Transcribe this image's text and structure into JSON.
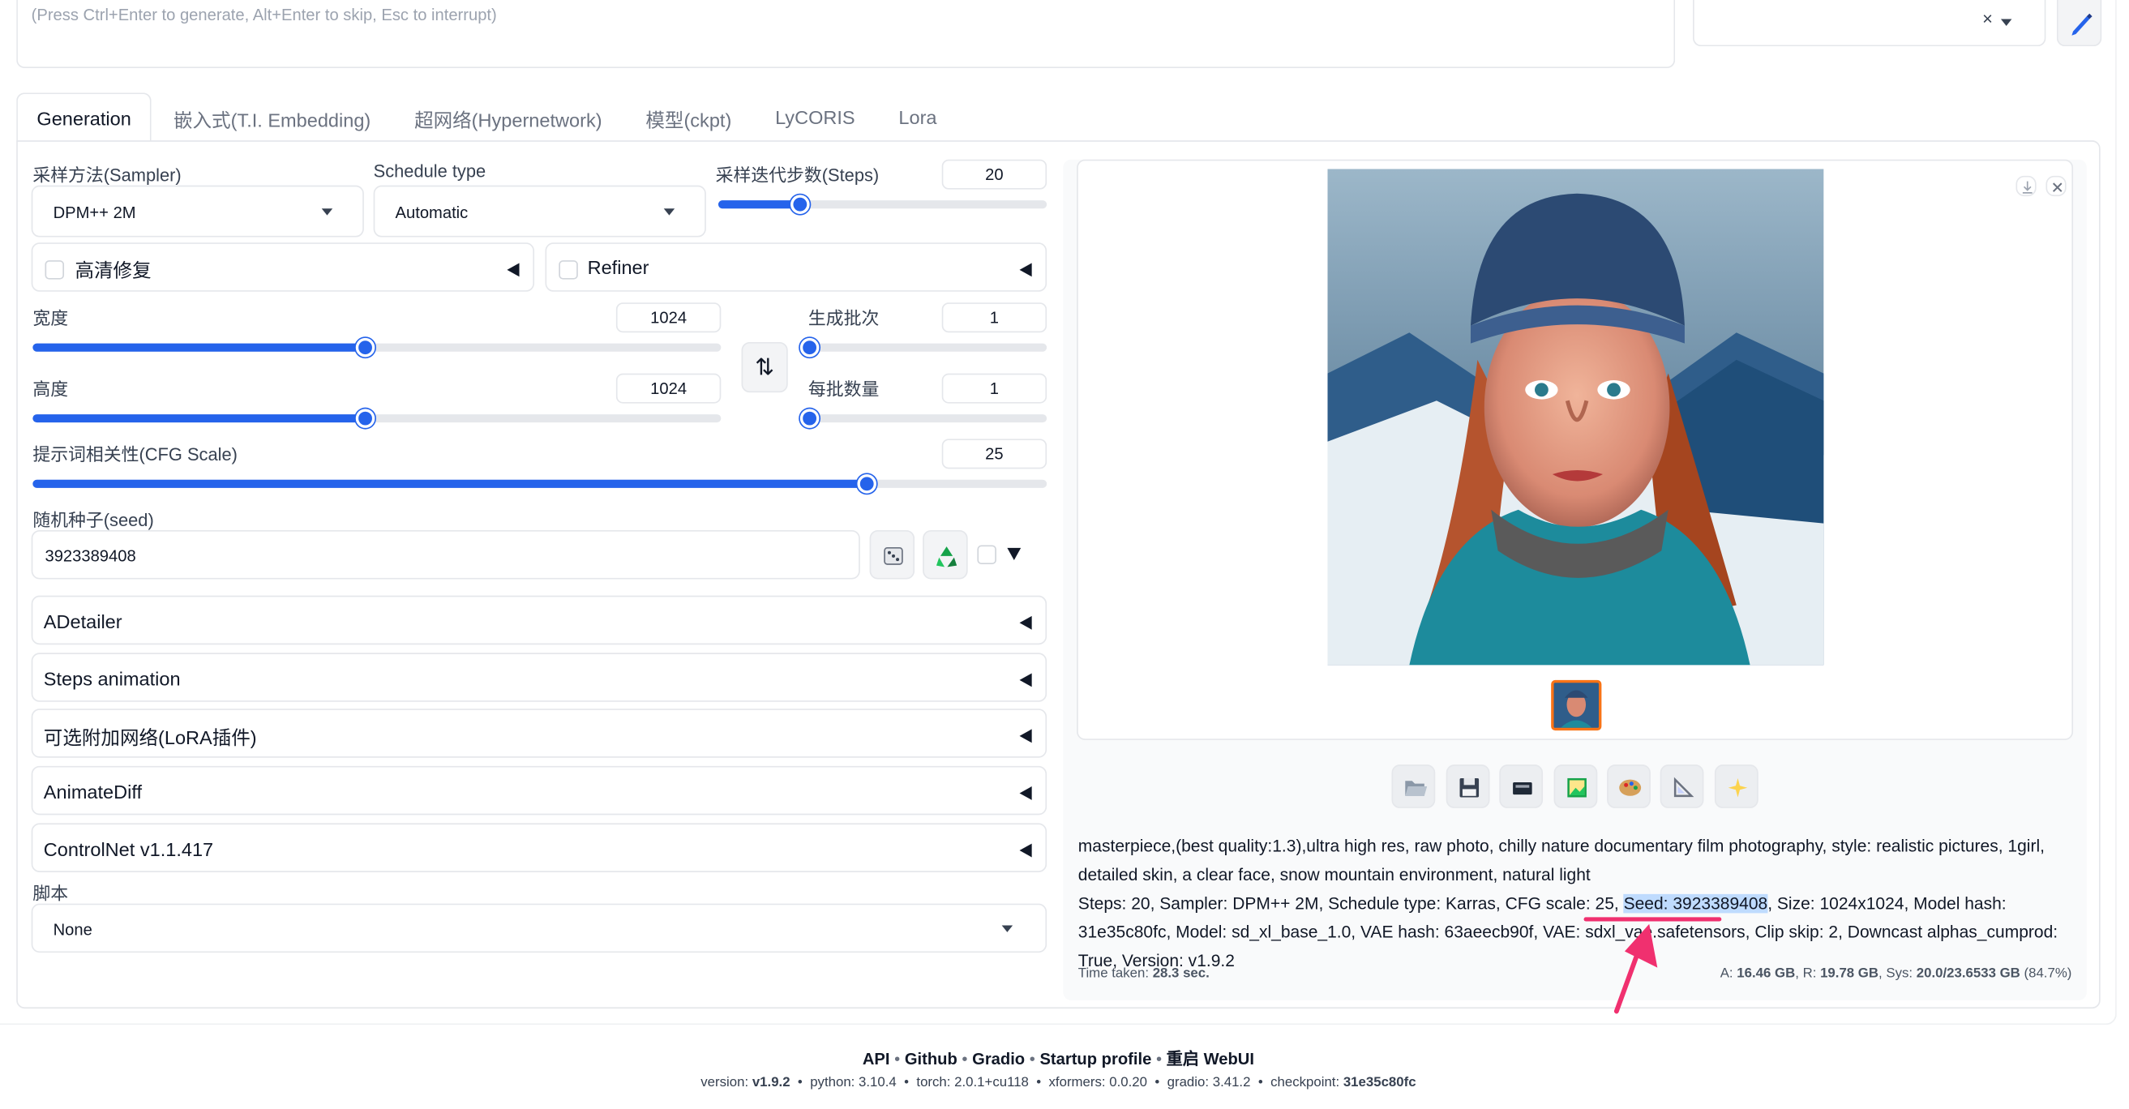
{
  "prompt": {
    "placeholder": "(Press Ctrl+Enter to generate, Alt+Enter to skip, Esc to interrupt)"
  },
  "styles": {
    "clear": "×"
  },
  "tabs": [
    "Generation",
    "嵌入式(T.I. Embedding)",
    "超网络(Hypernetwork)",
    "模型(ckpt)",
    "LyCORIS",
    "Lora"
  ],
  "sampler": {
    "label": "采样方法(Sampler)",
    "value": "DPM++ 2M"
  },
  "schedule": {
    "label": "Schedule type",
    "value": "Automatic"
  },
  "steps": {
    "label": "采样迭代步数(Steps)",
    "value": "20",
    "fraction": 0.247
  },
  "hires": {
    "label": "高清修复"
  },
  "refiner": {
    "label": "Refiner"
  },
  "width": {
    "label": "宽度",
    "value": "1024",
    "fraction": 0.484
  },
  "height": {
    "label": "高度",
    "value": "1024",
    "fraction": 0.484
  },
  "batch_count": {
    "label": "生成批次",
    "value": "1",
    "fraction": 0.0
  },
  "batch_size": {
    "label": "每批数量",
    "value": "1",
    "fraction": 0.0
  },
  "swap_icon": "⇅",
  "cfg": {
    "label": "提示词相关性(CFG Scale)",
    "value": "25",
    "fraction": 0.822
  },
  "seed": {
    "label": "随机种子(seed)",
    "value": "3923389408"
  },
  "accordions": [
    "ADetailer",
    "Steps animation",
    "可选附加网络(LoRA插件)",
    "AnimateDiff",
    "ControlNet v1.1.417"
  ],
  "script": {
    "label": "脚本",
    "value": "None"
  },
  "info": {
    "prompt_text": "masterpiece,(best quality:1.3),ultra high res, raw photo, chilly nature documentary film photography, style: realistic pictures, 1girl, detailed skin, a clear face, snow mountain environment, natural light",
    "params_a": "Steps: 20, Sampler: DPM++ 2M, Schedule type: Karras, CFG scale: 25, ",
    "seed_text": "Seed: 3923389408",
    "params_b": ", Size: 1024x1024, Model hash: 31e35c80fc,",
    "params_c": "Model: sd_xl_base_1.0, VAE hash: 63aeecb90f, VAE: sdxl_vae.safetensors, Clip skip: 2, Downcast alphas_cumprod: True, Version: v1.9.2"
  },
  "time": {
    "label": "Time taken: ",
    "value": "28.3 sec."
  },
  "mem": {
    "a_label": "A: ",
    "a": "16.46 GB",
    "r_label": ", R: ",
    "r": "19.78 GB",
    "s_label": ", Sys: ",
    "s": "20.0/23.6533 GB",
    "pct": " (84.7%)"
  },
  "footer": {
    "links": [
      "API",
      "Github",
      "Gradio",
      "Startup profile",
      "重启 WebUI"
    ],
    "sep": "•",
    "versions": [
      {
        "k": "version: ",
        "v": "v1.9.2"
      },
      {
        "k": "python: ",
        "v": "3.10.4"
      },
      {
        "k": "torch: ",
        "v": "2.0.1+cu118"
      },
      {
        "k": "xformers: ",
        "v": "0.0.20"
      },
      {
        "k": "gradio: ",
        "v": "3.41.2"
      },
      {
        "k": "checkpoint: ",
        "v": "31e35c80fc"
      }
    ]
  },
  "colors": {
    "accent": "#2563eb",
    "annotation": "#f0306f",
    "seed_highlight": "#bfdbfe"
  }
}
